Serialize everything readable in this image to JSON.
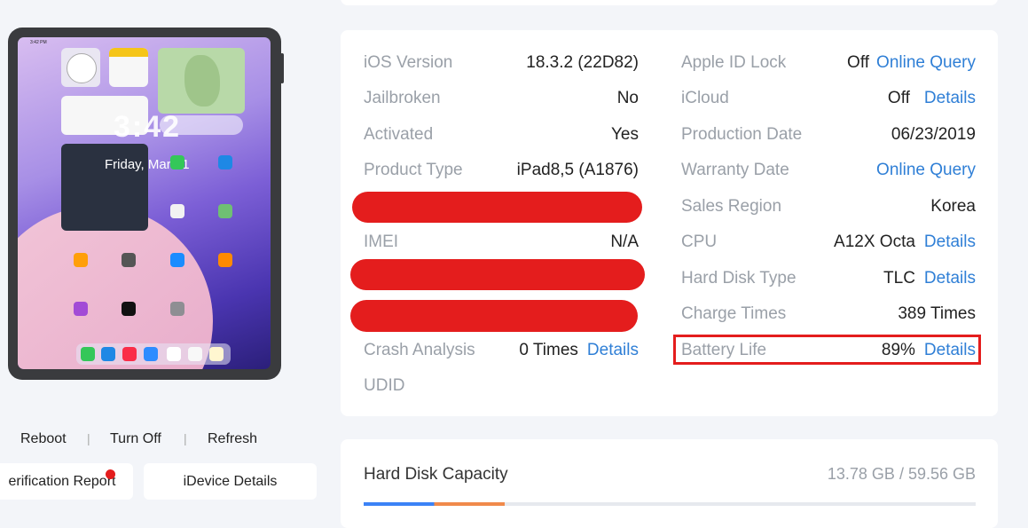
{
  "device_panel": {
    "screen": {
      "time": "3:42",
      "date": "Friday, Mar 21",
      "status_time": "3:42 PM"
    },
    "actions": [
      "Reboot",
      "Turn Off",
      "Refresh"
    ],
    "buttons": {
      "verification_report": "erification Report",
      "idevice_details": "iDevice Details"
    }
  },
  "info": {
    "left": [
      {
        "label": "iOS Version",
        "value": "18.3.2 (22D82)"
      },
      {
        "label": "Jailbroken",
        "value": "No"
      },
      {
        "label": "Activated",
        "value": "Yes"
      },
      {
        "label": "Product Type",
        "value": "iPad8,5 (A1876)"
      },
      {
        "label": "IMEI",
        "value": "N/A"
      },
      {
        "label": "Crash Analysis",
        "value": "0 Times",
        "link": "Details"
      },
      {
        "label": "UDID",
        "value": ""
      }
    ],
    "right": [
      {
        "label": "Apple ID Lock",
        "value": "Off",
        "link": "Online Query"
      },
      {
        "label": "iCloud",
        "value": "Off",
        "link": "Details"
      },
      {
        "label": "Production Date",
        "value": "06/23/2019"
      },
      {
        "label": "Warranty Date",
        "value": "",
        "link": "Online Query"
      },
      {
        "label": "Sales Region",
        "value": "Korea"
      },
      {
        "label": "CPU",
        "value": "A12X Octa",
        "link": "Details"
      },
      {
        "label": "Hard Disk Type",
        "value": "TLC",
        "link": "Details"
      },
      {
        "label": "Charge Times",
        "value": "389 Times"
      },
      {
        "label": "Battery Life",
        "value": "89%",
        "link": "Details"
      }
    ]
  },
  "disk": {
    "title": "Hard Disk Capacity",
    "value": "13.78 GB / 59.56 GB",
    "used_fraction": 0.23
  },
  "colors": {
    "accent": "#2f7fd6",
    "redaction": "#e41d1d",
    "label": "#9aa0a8"
  }
}
